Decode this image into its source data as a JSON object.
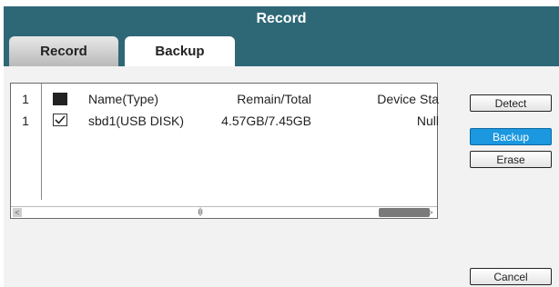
{
  "window": {
    "title": "Record"
  },
  "tabs": [
    {
      "label": "Record",
      "active": false
    },
    {
      "label": "Backup",
      "active": true
    }
  ],
  "table": {
    "header": {
      "index": "1",
      "name": "Name(Type)",
      "remain": "Remain/Total",
      "status": "Device Sta"
    },
    "rows": [
      {
        "index": "1",
        "checked": true,
        "name": "sbd1(USB DISK)",
        "remain": "4.57GB/7.45GB",
        "status": "Null"
      }
    ]
  },
  "buttons": {
    "detect": "Detect",
    "backup": "Backup",
    "erase": "Erase",
    "cancel": "Cancel"
  },
  "colors": {
    "titlebar": "#2e6877",
    "accent": "#1b98e0"
  }
}
